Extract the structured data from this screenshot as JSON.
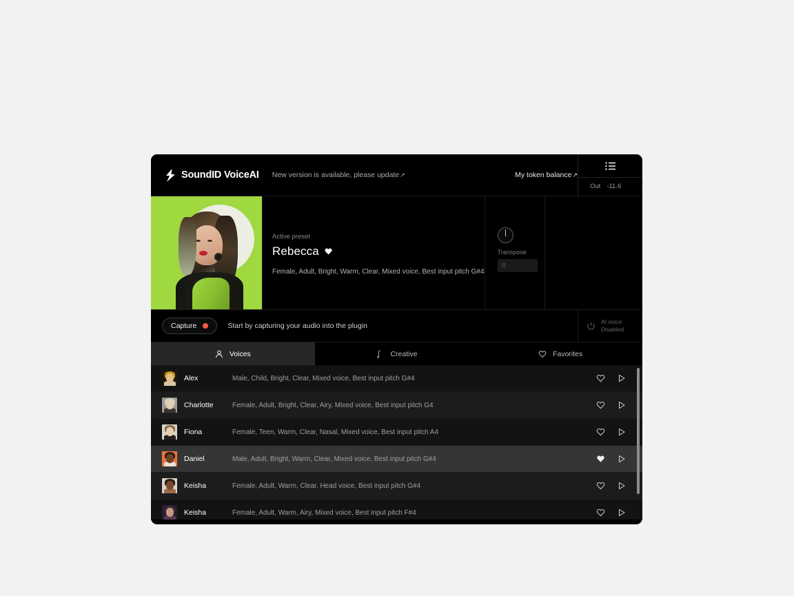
{
  "header": {
    "logo_text": "SoundID VoiceAI",
    "logo_icon": "bolt-icon",
    "update_message": "New version is available, please update",
    "update_arrow": "↗",
    "token_balance": "My token balance",
    "token_arrow": "↗",
    "list_icon": "list-icon",
    "out_label": "Out",
    "out_value": "-11.6"
  },
  "hero": {
    "preset_label": "Active preset",
    "preset_name": "Rebecca",
    "favorite_icon": "heart-filled-icon",
    "preset_attributes": "Female, Adult, Bright, Warm, Clear, Mixed voice, Best input pitch  G#4",
    "knob": {
      "label": "Transpose",
      "value": "0"
    },
    "art_background": "#9fd93f"
  },
  "capture": {
    "button_label": "Capture",
    "record_icon": "record-dot-icon",
    "record_color": "#f25c3e",
    "hint": "Start by capturing your audio into the plugin",
    "ai_voice_icon": "power-icon",
    "ai_voice_title": "AI voice",
    "ai_voice_state": "Disabled"
  },
  "tabs": [
    {
      "label": "Voices",
      "icon": "person-icon",
      "active": true
    },
    {
      "label": "Creative",
      "icon": "music-note-icon",
      "active": false
    },
    {
      "label": "Favorites",
      "icon": "heart-outline-icon",
      "active": false
    }
  ],
  "voice_list": {
    "favorite_icon": "heart-outline-icon",
    "favorite_icon_active": "heart-filled-icon",
    "play_icon": "play-icon",
    "rows": [
      {
        "name": "Alex",
        "attributes": "Male, Child, Bright, Clear, Mixed voice, Best input pitch G#4",
        "favorited": false,
        "selected": false,
        "thumb_bg": "#221a09",
        "thumb_hair": "#c79a21",
        "thumb_face": "#e4c089",
        "thumb_body": "#d8c8a8"
      },
      {
        "name": "Charlotte",
        "attributes": "Female, Adult, Bright, Clear, Airy, Mixed voice, Best input pitch  G4",
        "favorited": false,
        "selected": false,
        "thumb_bg": "#9a9a96",
        "thumb_hair": "#d8cfbe",
        "thumb_face": "#e7cdb4",
        "thumb_body": "#3a3432"
      },
      {
        "name": "Fiona",
        "attributes": "Female, Teen, Warm, Clear, Nasal, Mixed voice, Best input pitch  A4",
        "favorited": false,
        "selected": false,
        "thumb_bg": "#cfd5c9",
        "thumb_hair": "#8a6a48",
        "thumb_face": "#e8cdb2",
        "thumb_body": "#24201d"
      },
      {
        "name": "Daniel",
        "attributes": "Male, Adult, Bright, Warm, Clear, Mixed voice, Best input pitch  G#4",
        "favorited": true,
        "selected": true,
        "thumb_bg": "#e8763c",
        "thumb_hair": "#2a1d15",
        "thumb_face": "#6b4128",
        "thumb_body": "#e8e2d6"
      },
      {
        "name": "Keisha",
        "attributes": "Female, Adult, Warm, Clear, Head voice, Best input pitch  G#4",
        "favorited": false,
        "selected": false,
        "thumb_bg": "#d8d2c8",
        "thumb_hair": "#2c1a12",
        "thumb_face": "#7b4a2e",
        "thumb_body": "#9a6b4a"
      },
      {
        "name": "Keisha",
        "attributes": "Female, Adult, Warm, Airy, Mixed voice, Best input pitch  F#4",
        "favorited": false,
        "selected": false,
        "thumb_bg": "#2b1d2c",
        "thumb_hair": "#40283a",
        "thumb_face": "#c59a84",
        "thumb_body": "#5a3a50"
      }
    ]
  }
}
